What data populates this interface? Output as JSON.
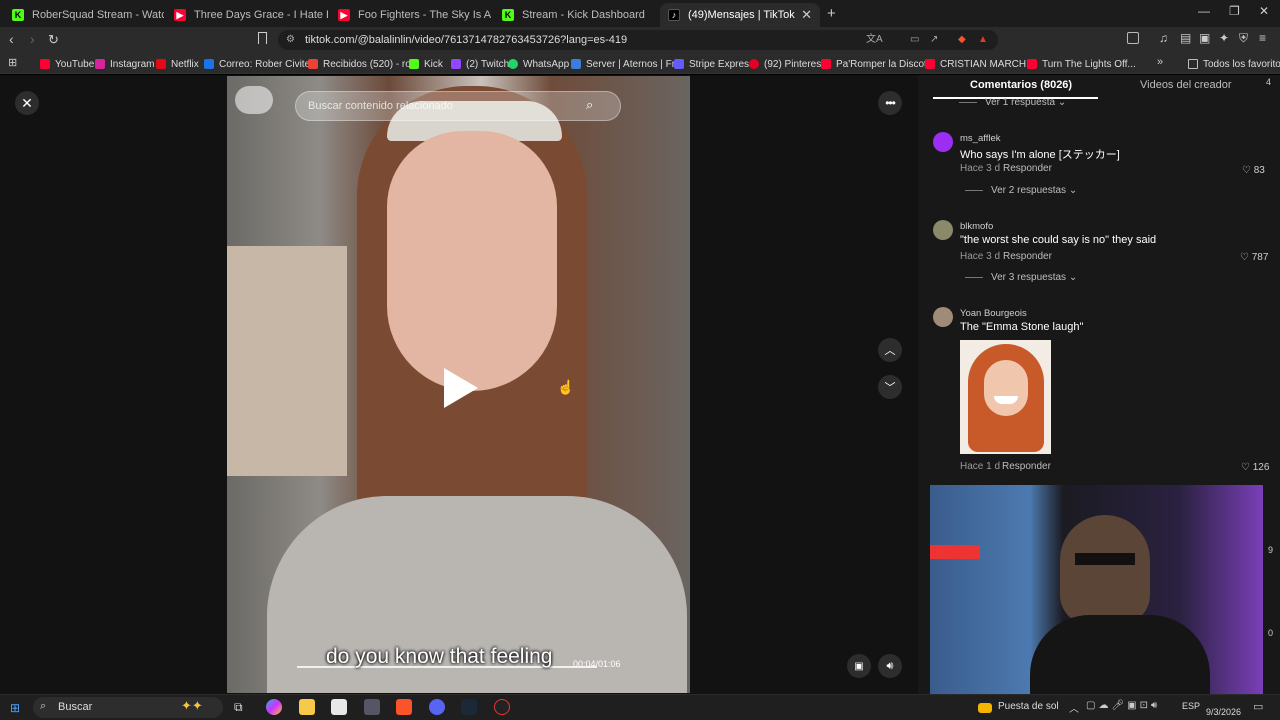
{
  "tabs": [
    {
      "title": "RoberSquad Stream - Watch Live",
      "color": "#53fc18",
      "glyph": "K"
    },
    {
      "title": "Three Days Grace - I Hate Everything",
      "color": "#ff0033",
      "glyph": "▶"
    },
    {
      "title": "Foo Fighters - The Sky Is A Neighbor",
      "color": "#ff0033",
      "glyph": "▶"
    },
    {
      "title": "Stream - Kick Dashboard",
      "color": "#53fc18",
      "glyph": "K"
    },
    {
      "title": "(49)Mensajes | TikTok",
      "color": "#ffffff",
      "glyph": "♪"
    }
  ],
  "address_bar": {
    "url": "tiktok.com/@balalinlin/video/7613714782763453726?lang=es-419"
  },
  "bookmarks": [
    {
      "label": "YouTube",
      "color": "#ff0033"
    },
    {
      "label": "Instagram",
      "color": "#d6249f"
    },
    {
      "label": "Netflix",
      "color": "#e50914"
    },
    {
      "label": "Correo: Rober Civite...",
      "color": "#1a73e8"
    },
    {
      "label": "Recibidos (520) - ro...",
      "color": "#ea4335"
    },
    {
      "label": "Kick",
      "color": "#53fc18"
    },
    {
      "label": "(2) Twitch",
      "color": "#9146ff"
    },
    {
      "label": "WhatsApp",
      "color": "#25d366"
    },
    {
      "label": "Server | Aternos | Fr...",
      "color": "#3b7dd8"
    },
    {
      "label": "Stripe Express",
      "color": "#635bff"
    },
    {
      "label": "(92) Pinterest",
      "color": "#e60023"
    },
    {
      "label": "Pa'Romper la Discot...",
      "color": "#ff0033"
    },
    {
      "label": "CRISTIAN MARCHI...",
      "color": "#ff0033"
    },
    {
      "label": "Turn The Lights Off...",
      "color": "#ff0033"
    }
  ],
  "bookmarks_all": "Todos los favoritos",
  "video": {
    "search_placeholder": "Buscar contenido relacionado",
    "caption": "do you know that feeling",
    "time": "00:04/01:06"
  },
  "comments_panel": {
    "tab_comments": "Comentarios (8026)",
    "tab_creator": "Videos del creador",
    "top_replies": "Ver 1 respuesta",
    "items": [
      {
        "user": "ms_afflek",
        "text": "Who says I'm alone [ステッカー]",
        "time": "Hace 3 d",
        "reply": "Responder",
        "likes": "83",
        "replies": "Ver 2 respuestas",
        "avatar": "#9b2ef2"
      },
      {
        "user": "blkmofo",
        "text": "\"the worst she could say is no\" they said",
        "time": "Hace 3 d",
        "reply": "Responder",
        "likes": "787",
        "replies": "Ver 3 respuestas",
        "avatar": "#8a8a6a"
      },
      {
        "user": "Yoan Bourgeois",
        "text": "The \"Emma Stone laugh\"",
        "time": "Hace 1 d",
        "reply": "Responder",
        "likes": "126",
        "replies": "",
        "avatar": "#a08a78"
      }
    ]
  },
  "overlay_numbers": [
    "4",
    "9",
    "0"
  ],
  "taskbar": {
    "search_label": "Buscar",
    "weather": "Puesta de sol",
    "language": "ESP",
    "date": "9/3/2026"
  },
  "colors": {
    "tiktok_red": "#fe2c55",
    "kick_green": "#53fc18",
    "panel_bg": "#181818"
  }
}
